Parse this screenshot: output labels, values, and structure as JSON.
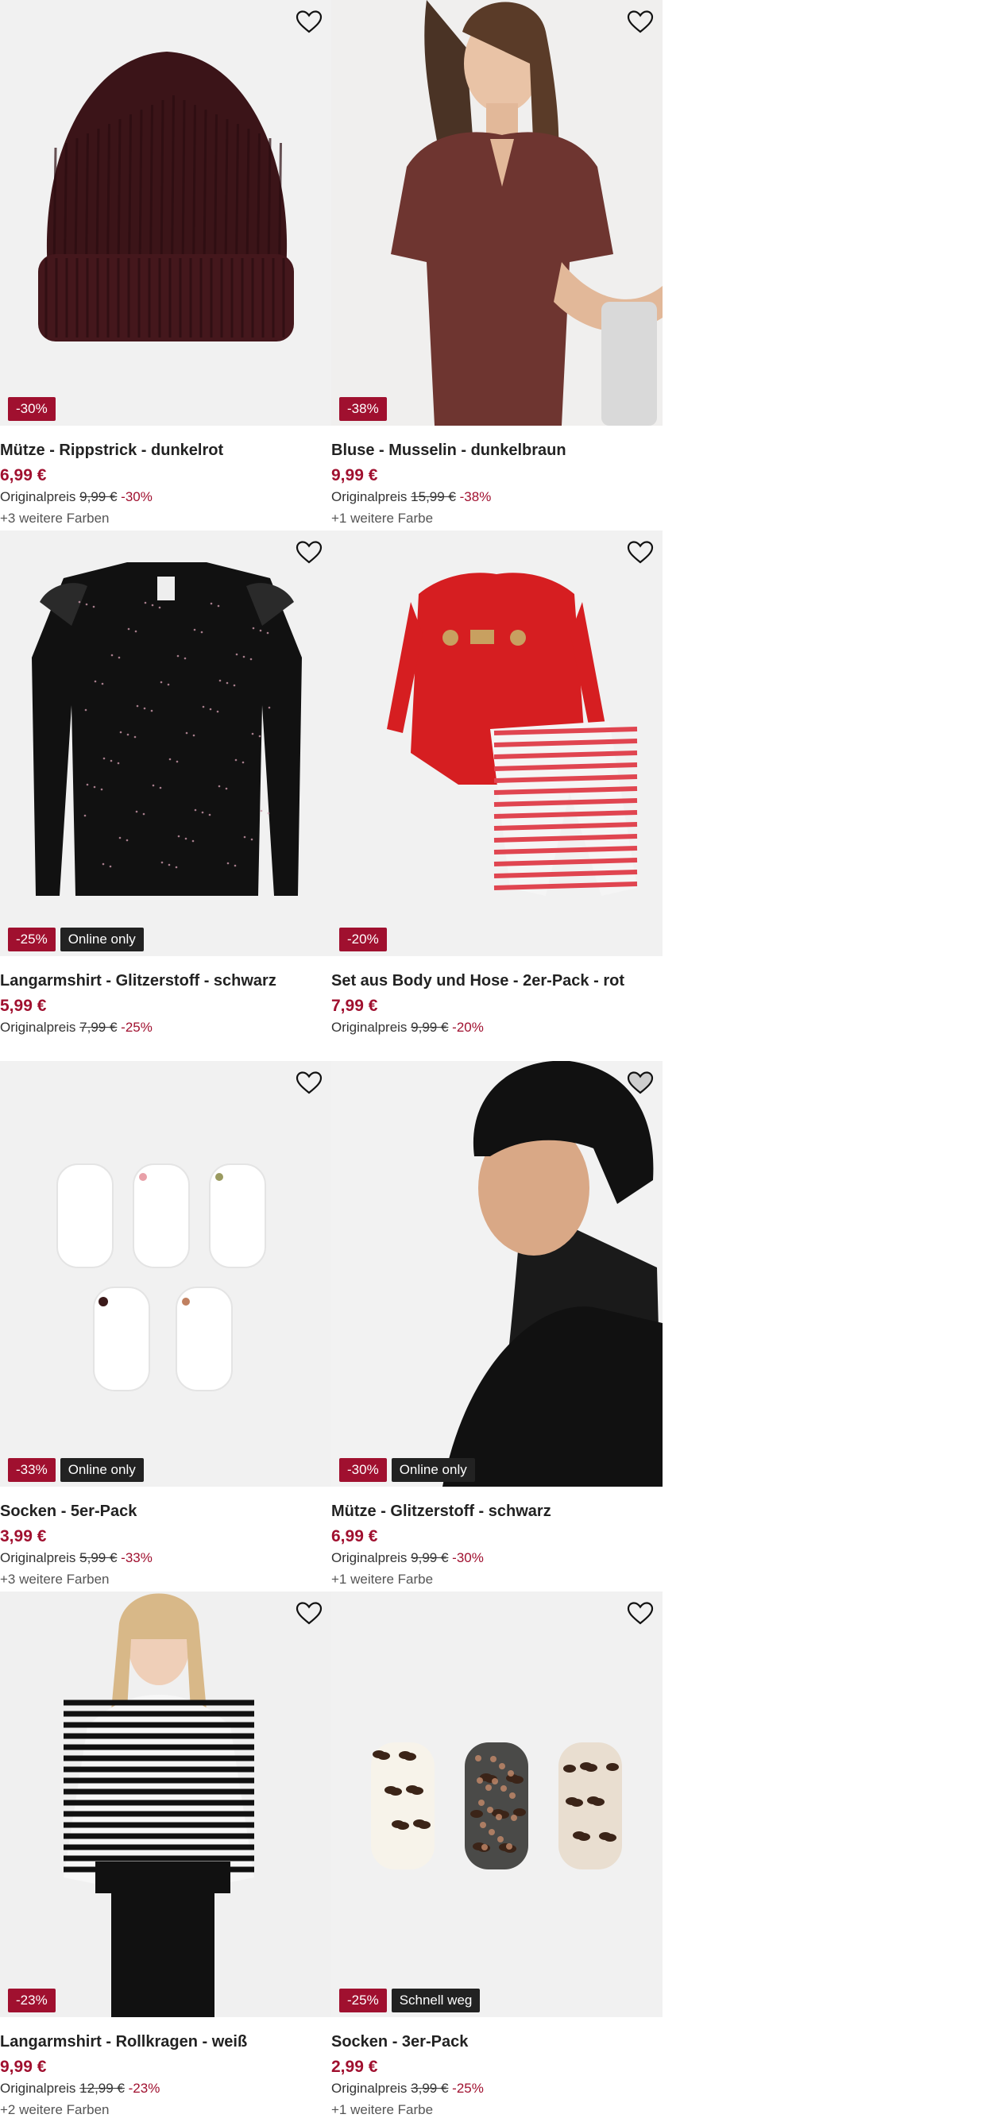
{
  "products": [
    {
      "title": "Mütze - Rippstrick - dunkelrot",
      "price": "6,99 €",
      "orig_label": "Originalpreis",
      "orig_price": "9,99 €",
      "discount": "-30%",
      "badges": [
        {
          "text": "-30%",
          "kind": "red"
        }
      ],
      "colors": "+3 weitere Farben",
      "image": "beanie-burgundy",
      "fav_active": false
    },
    {
      "title": "Bluse - Musselin - dunkelbraun",
      "price": "9,99 €",
      "orig_label": "Originalpreis",
      "orig_price": "15,99 €",
      "discount": "-38%",
      "badges": [
        {
          "text": "-38%",
          "kind": "red"
        }
      ],
      "colors": "+1 weitere Farbe",
      "image": "blouse-model",
      "fav_active": false
    },
    {
      "title": "Langarmshirt - Glitzerstoff - schwarz",
      "price": "5,99 €",
      "orig_label": "Originalpreis",
      "orig_price": "7,99 €",
      "discount": "-25%",
      "badges": [
        {
          "text": "-25%",
          "kind": "red"
        },
        {
          "text": "Online only",
          "kind": "dark"
        }
      ],
      "colors": "",
      "image": "glitter-shirt",
      "fav_active": false
    },
    {
      "title": "Set aus Body und Hose - 2er-Pack - rot",
      "price": "7,99 €",
      "orig_label": "Originalpreis",
      "orig_price": "9,99 €",
      "discount": "-20%",
      "badges": [
        {
          "text": "-20%",
          "kind": "red"
        }
      ],
      "colors": "",
      "image": "baby-set",
      "fav_active": false
    },
    {
      "title": "Socken - 5er-Pack",
      "price": "3,99 €",
      "orig_label": "Originalpreis",
      "orig_price": "5,99 €",
      "discount": "-33%",
      "badges": [
        {
          "text": "-33%",
          "kind": "red"
        },
        {
          "text": "Online only",
          "kind": "dark"
        }
      ],
      "colors": "+3 weitere Farben",
      "image": "socks-white",
      "fav_active": false
    },
    {
      "title": "Mütze - Glitzerstoff - schwarz",
      "price": "6,99 €",
      "orig_label": "Originalpreis",
      "orig_price": "9,99 €",
      "discount": "-30%",
      "badges": [
        {
          "text": "-30%",
          "kind": "red"
        },
        {
          "text": "Online only",
          "kind": "dark"
        }
      ],
      "colors": "+1 weitere Farbe",
      "image": "beanie-model",
      "fav_active": true
    },
    {
      "title": "Langarmshirt - Rollkragen - weiß",
      "price": "9,99 €",
      "orig_label": "Originalpreis",
      "orig_price": "12,99 €",
      "discount": "-23%",
      "badges": [
        {
          "text": "-23%",
          "kind": "red"
        }
      ],
      "colors": "+2 weitere Farben",
      "image": "turtleneck-model",
      "fav_active": false
    },
    {
      "title": "Socken - 3er-Pack",
      "price": "2,99 €",
      "orig_label": "Originalpreis",
      "orig_price": "3,99 €",
      "discount": "-25%",
      "badges": [
        {
          "text": "-25%",
          "kind": "red"
        },
        {
          "text": "Schnell weg",
          "kind": "dark"
        }
      ],
      "colors": "+1 weitere Farbe",
      "image": "socks-leopard",
      "fav_active": false
    }
  ],
  "icons": {
    "favorite": "heart-outline-icon"
  },
  "colors": {
    "accent": "#a0102f",
    "badge_dark": "#222222",
    "image_bg": "#f1f1f1"
  }
}
